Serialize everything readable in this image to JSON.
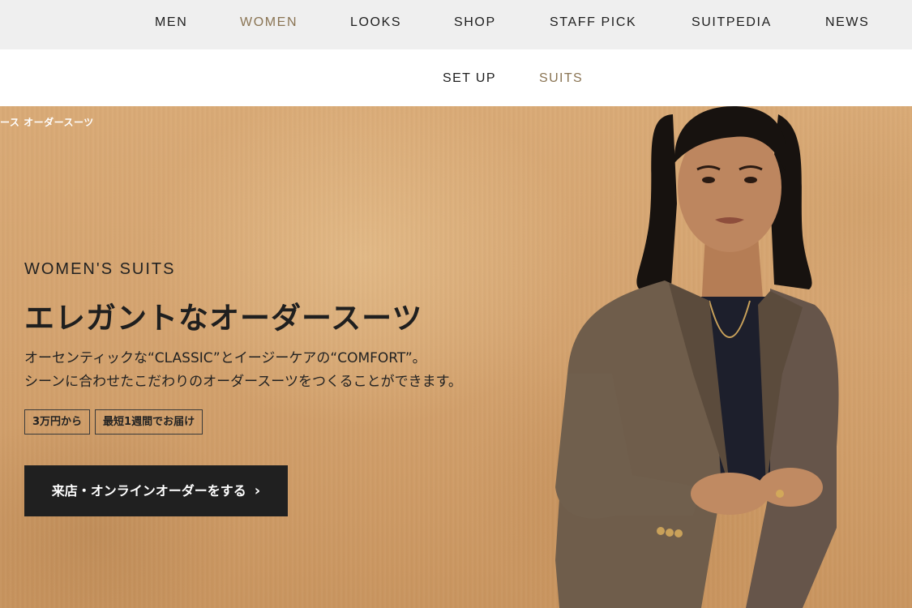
{
  "top_nav": {
    "items": [
      {
        "label": "MEN",
        "active": false
      },
      {
        "label": "WOMEN",
        "active": true
      },
      {
        "label": "LOOKS",
        "active": false
      },
      {
        "label": "SHOP",
        "active": false
      },
      {
        "label": "STAFF PICK",
        "active": false
      },
      {
        "label": "SUITPEDIA",
        "active": false
      },
      {
        "label": "NEWS",
        "active": false
      }
    ]
  },
  "sub_nav": {
    "items": [
      {
        "label": "SET UP",
        "active": false
      },
      {
        "label": "SUITS",
        "active": true
      }
    ]
  },
  "hero": {
    "breadcrumb": "ース オーダースーツ",
    "kicker": "WOMEN'S SUITS",
    "headline": "エレガントなオーダースーツ",
    "description": [
      "オーセンティックな“CLASSIC”とイージーケアの“COMFORT”。",
      "シーンに合わせたこだわりのオーダースーツをつくることができます。"
    ],
    "tags": [
      "3万円から",
      "最短1週間でお届け"
    ],
    "cta_label": "来店・オンラインオーダーをする",
    "cta_icon": "chevron-right-icon"
  },
  "colors": {
    "accent_active": "#8a7453",
    "top_nav_bg": "#efefef",
    "cta_bg": "#202020",
    "hero_bg": "#d4a36f"
  }
}
